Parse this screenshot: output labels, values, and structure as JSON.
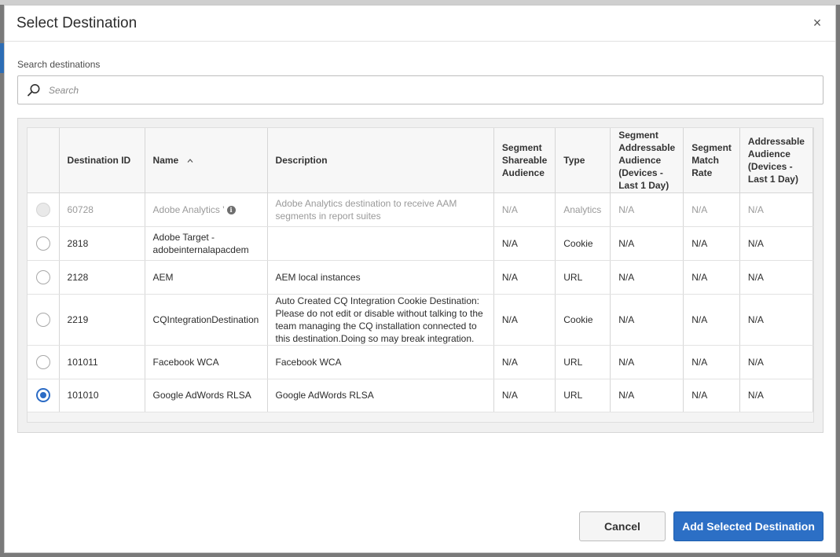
{
  "dialog": {
    "title": "Select Destination",
    "close_symbol": "×",
    "close_icon": "close-icon"
  },
  "search": {
    "label": "Search destinations",
    "placeholder": "Search",
    "value": "",
    "icon": "search-icon"
  },
  "table": {
    "columns": [
      {
        "key": "select",
        "label": ""
      },
      {
        "key": "destination_id",
        "label": "Destination ID"
      },
      {
        "key": "name",
        "label": "Name",
        "sort_icon": "sort-icon"
      },
      {
        "key": "description",
        "label": "Description"
      },
      {
        "key": "segment_shareable_audience",
        "label": "Segment Shareable Audience"
      },
      {
        "key": "type",
        "label": "Type"
      },
      {
        "key": "segment_addressable_audience",
        "label": "Segment Addressable Audience (Devices - Last 1 Day)"
      },
      {
        "key": "segment_match_rate",
        "label": "Segment Match Rate"
      },
      {
        "key": "addressable_audience",
        "label": "Addressable Audience (Devices - Last 1 Day)"
      }
    ],
    "rows": [
      {
        "selected": false,
        "disabled": true,
        "destination_id": "60728",
        "name": "Adobe Analytics '",
        "name_info_icon": "info-icon",
        "description": "Adobe Analytics destination to receive AAM segments in report suites",
        "segment_shareable_audience": "N/A",
        "type": "Analytics",
        "segment_addressable_audience": "N/A",
        "segment_match_rate": "N/A",
        "addressable_audience": "N/A"
      },
      {
        "selected": false,
        "disabled": false,
        "destination_id": "2818",
        "name": "Adobe Target - adobeinternalapacdem",
        "description": "",
        "segment_shareable_audience": "N/A",
        "type": "Cookie",
        "segment_addressable_audience": "N/A",
        "segment_match_rate": "N/A",
        "addressable_audience": "N/A"
      },
      {
        "selected": false,
        "disabled": false,
        "destination_id": "2128",
        "name": "AEM",
        "description": "AEM local instances",
        "segment_shareable_audience": "N/A",
        "type": "URL",
        "segment_addressable_audience": "N/A",
        "segment_match_rate": "N/A",
        "addressable_audience": "N/A"
      },
      {
        "selected": false,
        "disabled": false,
        "destination_id": "2219",
        "name": "CQIntegrationDestination",
        "description": "Auto Created CQ Integration Cookie Destination: Please do not edit or disable without talking to the team managing the CQ installation connected to this destination.Doing so may break integration.",
        "segment_shareable_audience": "N/A",
        "type": "Cookie",
        "segment_addressable_audience": "N/A",
        "segment_match_rate": "N/A",
        "addressable_audience": "N/A"
      },
      {
        "selected": false,
        "disabled": false,
        "destination_id": "101011",
        "name": "Facebook WCA",
        "description": "Facebook WCA",
        "segment_shareable_audience": "N/A",
        "type": "URL",
        "segment_addressable_audience": "N/A",
        "segment_match_rate": "N/A",
        "addressable_audience": "N/A"
      },
      {
        "selected": true,
        "disabled": false,
        "destination_id": "101010",
        "name": "Google AdWords RLSA",
        "description": "Google AdWords RLSA",
        "segment_shareable_audience": "N/A",
        "type": "URL",
        "segment_addressable_audience": "N/A",
        "segment_match_rate": "N/A",
        "addressable_audience": "N/A"
      }
    ]
  },
  "footer": {
    "cancel_label": "Cancel",
    "primary_label": "Add Selected Destination"
  },
  "colors": {
    "primary": "#2c6fc5",
    "radio_selected": "#2b6bc5",
    "disabled_text": "#9a9a9a"
  }
}
